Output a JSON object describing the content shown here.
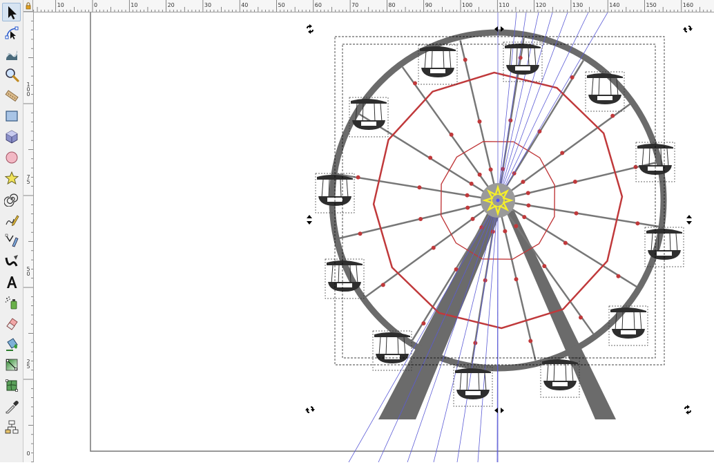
{
  "toolbox": {
    "tools": [
      {
        "id": "selector",
        "name": "selector-tool",
        "icon": "arrow-pointer-icon",
        "active": true
      },
      {
        "id": "node",
        "name": "node-tool",
        "icon": "node-editor-icon"
      },
      {
        "id": "tweak",
        "name": "tweak-tool",
        "icon": "tweak-wave-icon"
      },
      {
        "id": "zoom",
        "name": "zoom-tool",
        "icon": "magnifier-icon"
      },
      {
        "id": "measure",
        "name": "measure-tool",
        "icon": "ruler-icon"
      },
      {
        "id": "rect",
        "name": "rectangle-tool",
        "icon": "rectangle-icon"
      },
      {
        "id": "box3d",
        "name": "3d-box-tool",
        "icon": "cube-icon"
      },
      {
        "id": "ellipse",
        "name": "ellipse-tool",
        "icon": "circle-icon"
      },
      {
        "id": "star",
        "name": "star-tool",
        "icon": "star-icon"
      },
      {
        "id": "spiral",
        "name": "spiral-tool",
        "icon": "spiral-icon"
      },
      {
        "id": "pencil",
        "name": "pencil-tool",
        "icon": "pencil-icon"
      },
      {
        "id": "pen",
        "name": "pen-tool",
        "icon": "pen-bezier-icon"
      },
      {
        "id": "calligraphy",
        "name": "calligraphy-tool",
        "icon": "calligraphy-nib-icon"
      },
      {
        "id": "text",
        "name": "text-tool",
        "icon": "text-a-icon"
      },
      {
        "id": "spray",
        "name": "spray-tool",
        "icon": "spray-can-icon"
      },
      {
        "id": "eraser",
        "name": "eraser-tool",
        "icon": "eraser-icon"
      },
      {
        "id": "bucket",
        "name": "paint-bucket-tool",
        "icon": "paint-bucket-icon"
      },
      {
        "id": "gradient",
        "name": "gradient-tool",
        "icon": "gradient-icon"
      },
      {
        "id": "mesh",
        "name": "mesh-tool",
        "icon": "mesh-icon"
      },
      {
        "id": "dropper",
        "name": "dropper-tool",
        "icon": "eyedropper-icon"
      },
      {
        "id": "connector",
        "name": "connector-tool",
        "icon": "connector-diagram-icon"
      }
    ]
  },
  "rulers": {
    "horizontal_labels": [
      "10",
      "0",
      "10",
      "20",
      "30",
      "40",
      "50",
      "60",
      "70",
      "80",
      "90",
      "100",
      "110",
      "120",
      "130",
      "140",
      "150",
      "160"
    ],
    "vertical_labels": [
      "100",
      "75",
      "50",
      "25",
      "0"
    ]
  },
  "drawing": {
    "colors": {
      "rim": "#6b6b6b",
      "spokes_red": "#c0393b",
      "cabin": "#2e2e2e",
      "hub_ring": "#9a9a9a",
      "hub_star": "#f5ee2a",
      "guide_lines": "#5b5bd6",
      "selection_dash": "#000000",
      "page_border": "#777777"
    }
  }
}
